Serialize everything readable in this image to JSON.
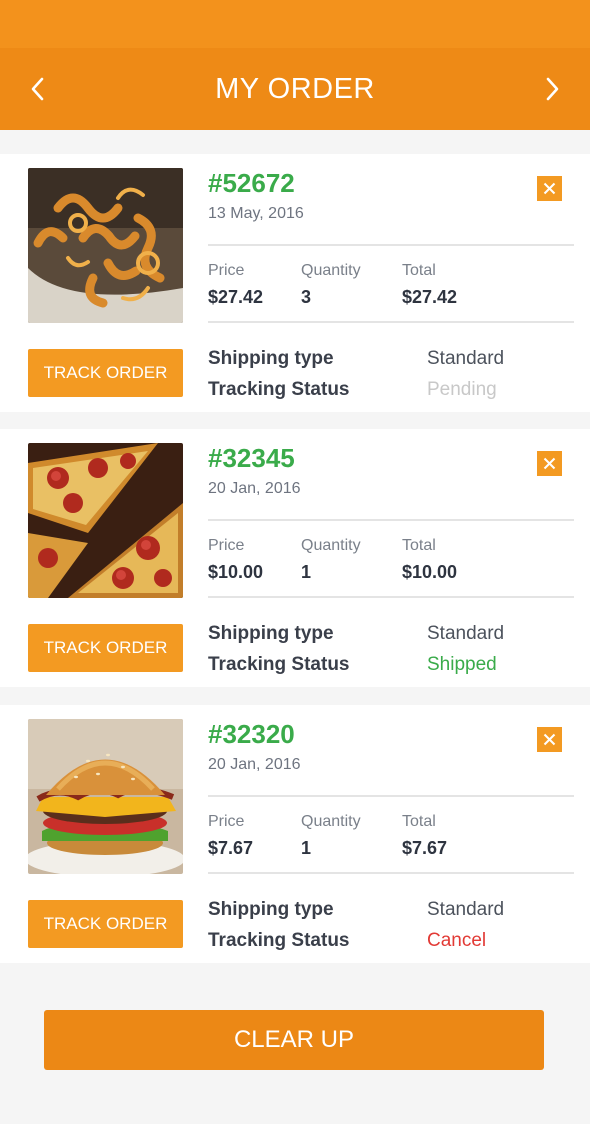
{
  "header": {
    "title": "MY ORDER",
    "back_icon": "chevron-left-icon",
    "forward_icon": "chevron-right-icon"
  },
  "orders": [
    {
      "number": "#52672",
      "date": "13 May, 2016",
      "image": "curly-fries",
      "price_label": "Price",
      "price": "$27.42",
      "quantity_label": "Quantity",
      "quantity": "3",
      "total_label": "Total",
      "total": "$27.42",
      "track_label": "TRACK ORDER",
      "shipping_type_label": "Shipping type",
      "shipping_type": "Standard",
      "tracking_status_label": "Tracking Status",
      "tracking_status": "Pending",
      "status_color": "#c8c8c8"
    },
    {
      "number": "#32345",
      "date": "20 Jan, 2016",
      "image": "pepperoni-pizza",
      "price_label": "Price",
      "price": "$10.00",
      "quantity_label": "Quantity",
      "quantity": "1",
      "total_label": "Total",
      "total": "$10.00",
      "track_label": "TRACK ORDER",
      "shipping_type_label": "Shipping type",
      "shipping_type": "Standard",
      "tracking_status_label": "Tracking Status",
      "tracking_status": "Shipped",
      "status_color": "#3aab4a"
    },
    {
      "number": "#32320",
      "date": "20 Jan, 2016",
      "image": "cheeseburger",
      "price_label": "Price",
      "price": "$7.67",
      "quantity_label": "Quantity",
      "quantity": "1",
      "total_label": "Total",
      "total": "$7.67",
      "track_label": "TRACK ORDER",
      "shipping_type_label": "Shipping type",
      "shipping_type": "Standard",
      "tracking_status_label": "Tracking Status",
      "tracking_status": "Cancel",
      "status_color": "#e23a35"
    }
  ],
  "footer": {
    "clear_label": "CLEAR UP"
  },
  "colors": {
    "accent": "#ee8a16",
    "button": "#f39a22",
    "order_number": "#3aab4a"
  }
}
